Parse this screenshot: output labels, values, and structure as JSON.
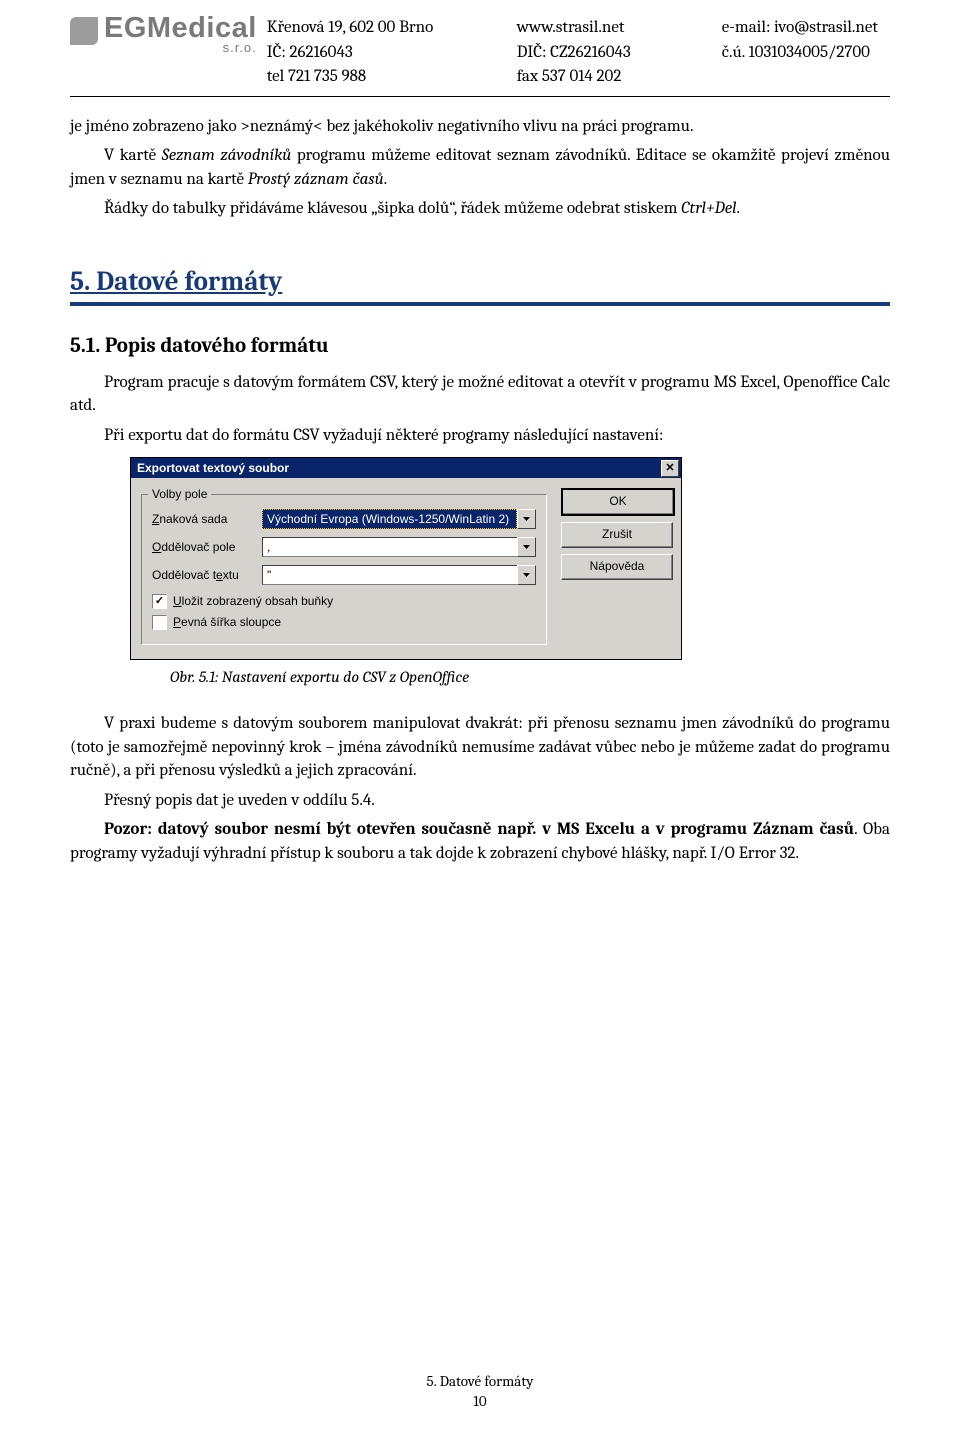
{
  "header": {
    "logo_main": "EGMedical",
    "logo_sub": "s.r.o.",
    "col1": {
      "l1": "Křenová 19, 602 00 Brno",
      "l2": "IČ: 26216043",
      "l3": "tel 721 735 988"
    },
    "col2": {
      "l1": "www.strasil.net",
      "l2": "DIČ: CZ26216043",
      "l3": "fax 537 014 202"
    },
    "col3": {
      "l1": "e-mail: ivo@strasil.net",
      "l2": "č.ú. 1031034005/2700"
    }
  },
  "para1": "je jméno zobrazeno jako >neznámý<  bez jakéhokoliv negativního vlivu na práci programu.",
  "para2a": "V kartě ",
  "para2b": "Seznam závodníků",
  "para2c": " programu můžeme editovat seznam závodníků. Editace se okamžitě projeví změnou jmen v seznamu na kartě ",
  "para2d": "Prostý záznam časů",
  "para2e": ". ",
  "para3a": "Řádky do tabulky přidáváme klávesou „šipka dolů“, řádek můžeme odebrat stiskem ",
  "para3b": "Ctrl+Del",
  "para3c": ".",
  "sec5": "5.   Datové formáty",
  "sec51": "5.1.   Popis datového formátu",
  "para4": "Program pracuje s datovým formátem CSV, který je možné editovat a otevřít v programu MS Excel, Openoffice Calc atd.",
  "para5": "Při exportu dat do formátu CSV vyžadují některé programy následující nastavení:",
  "dialog": {
    "title": "Exportovat textový soubor",
    "group_label": "Volby pole",
    "row1_label_pre": "Z",
    "row1_label_post": "naková sada",
    "row1_value": "Východní Evropa (Windows-1250/WinLatin 2)",
    "row2_label_pre": "O",
    "row2_label_post": "ddělovač pole",
    "row2_value": ",",
    "row3_label": "Oddělovač t",
    "row3_label_u": "e",
    "row3_label_post": "xtu",
    "row3_value": "\"",
    "chk1_pre": "U",
    "chk1_post": "ložit zobrazený obsah buňky",
    "chk1_checked": "✓",
    "chk2_pre": "P",
    "chk2_post": "evná šířka sloupce",
    "btn_ok": "OK",
    "btn_cancel": "Zrušit",
    "btn_help": "Nápověda"
  },
  "caption": "Obr. 5.1: Nastavení exportu do CSV z OpenOffice",
  "para6": "V praxi budeme s datovým souborem manipulovat dvakrát: při přenosu seznamu jmen závodníků do programu (toto je samozřejmě nepovinný krok – jména závodníků nemusíme zadávat vůbec nebo je můžeme zadat do programu ručně), a při přenosu výsledků a jejich zpracování.",
  "para7": "Přesný popis dat je uveden v oddílu 5.4.",
  "para8a": "Pozor: datový soubor nesmí být otevřen současně např. v MS Excelu a v programu Záznam časů",
  "para8b": ". Oba programy vyžadují výhradní přístup k souboru a tak dojde k zobrazení chybové hlášky, např. I/O Error 32.",
  "footer": {
    "section": "5. Datové formáty",
    "page": "10"
  }
}
